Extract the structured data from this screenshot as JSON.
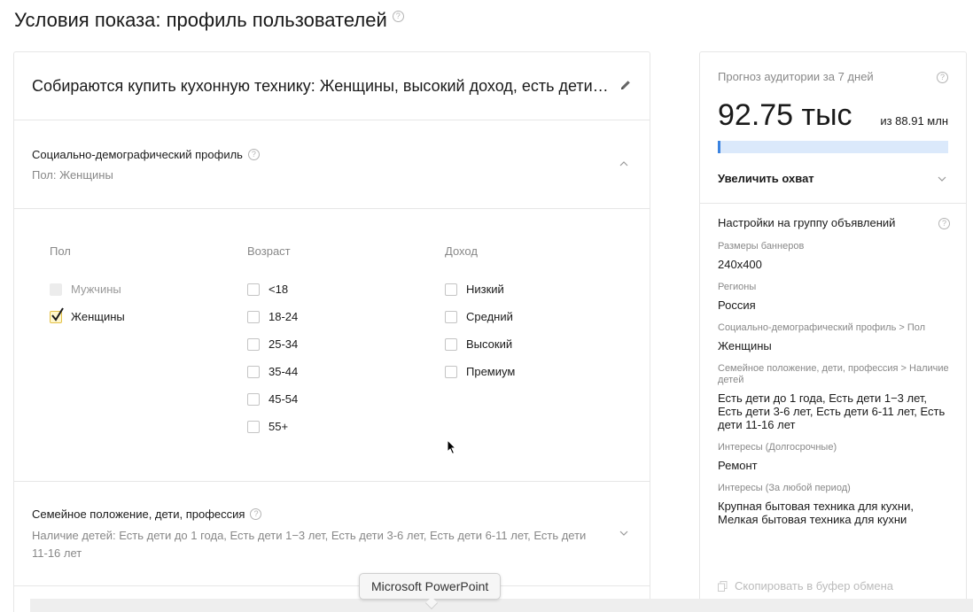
{
  "page": {
    "title": "Условия показа: профиль пользователей",
    "help_icon": "question-circle-icon"
  },
  "segment": {
    "title": "Собираются купить кухонную технику: Женщины, высокий доход, есть дети…",
    "edit_icon": "pencil-icon"
  },
  "demographics": {
    "title": "Социально-демографический профиль",
    "summary": "Пол: Женщины",
    "expanded": true,
    "gender": {
      "title": "Пол",
      "options": [
        {
          "label": "Мужчины",
          "checked": false,
          "disabled": true
        },
        {
          "label": "Женщины",
          "checked": true,
          "disabled": false
        }
      ]
    },
    "age": {
      "title": "Возраст",
      "options": [
        {
          "label": "<18",
          "checked": false
        },
        {
          "label": "18-24",
          "checked": false
        },
        {
          "label": "25-34",
          "checked": false
        },
        {
          "label": "35-44",
          "checked": false
        },
        {
          "label": "45-54",
          "checked": false
        },
        {
          "label": "55+",
          "checked": false
        }
      ]
    },
    "income": {
      "title": "Доход",
      "options": [
        {
          "label": "Низкий",
          "checked": false
        },
        {
          "label": "Средний",
          "checked": false
        },
        {
          "label": "Высокий",
          "checked": false
        },
        {
          "label": "Премиум",
          "checked": false
        }
      ]
    }
  },
  "family": {
    "title": "Семейное положение, дети, профессия",
    "summary": "Наличие детей: Есть дети до 1 года, Есть дети 1−3 лет, Есть дети 3-6 лет, Есть дети 6-11 лет, Есть дети 11-16 лет",
    "expanded": false
  },
  "forecast": {
    "label": "Прогноз аудитории за 7 дней",
    "value": "92.75 тыс",
    "total": "из 88.91 млн",
    "progress_fraction": 0.01,
    "increase_label": "Увеличить охват",
    "colors": {
      "bar_track": "#dbe9fb",
      "bar_fill": "#3b83e0"
    }
  },
  "settings": {
    "title": "Настройки на группу объявлений",
    "items": [
      {
        "label": "Размеры баннеров",
        "value": "240x400"
      },
      {
        "label": "Регионы",
        "value": "Россия"
      },
      {
        "label": "Социально-демографический профиль > Пол",
        "value": "Женщины"
      },
      {
        "label": "Семейное положение, дети, профессия > Наличие детей",
        "value": "Есть дети до 1 года, Есть дети 1−3 лет, Есть дети 3-6 лет, Есть дети 6-11 лет, Есть дети 11-16 лет"
      },
      {
        "label": "Интересы (Долгосрочные)",
        "value": "Ремонт"
      },
      {
        "label": "Интересы (За любой период)",
        "value": "Крупная бытовая техника для кухни, Мелкая бытовая техника для кухни"
      }
    ],
    "copy_label": "Скопировать в буфер обмена"
  },
  "tooltip": {
    "text": "Microsoft PowerPoint"
  }
}
